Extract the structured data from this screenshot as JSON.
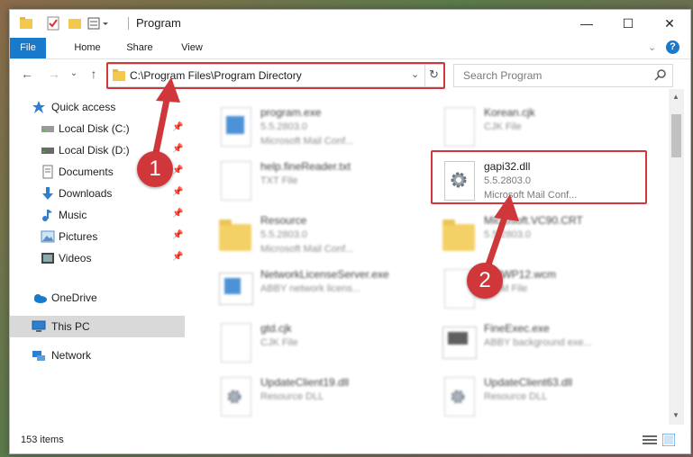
{
  "window": {
    "title": "Program",
    "accent": "#1979ca",
    "highlight": "#d0373b"
  },
  "ribbon": {
    "tabs": [
      "File",
      "Home",
      "Share",
      "View"
    ]
  },
  "address": {
    "path": "C:\\Program Files\\Program Directory",
    "search_placeholder": "Search Program"
  },
  "sidebar": {
    "items": [
      {
        "label": "Quick access",
        "icon": "star-icon"
      },
      {
        "label": "Local Disk (C:)",
        "icon": "drive-icon",
        "pinned": true
      },
      {
        "label": "Local Disk (D:)",
        "icon": "drive-icon",
        "pinned": true
      },
      {
        "label": "Documents",
        "icon": "documents-icon",
        "pinned": true
      },
      {
        "label": "Downloads",
        "icon": "download-icon",
        "pinned": true
      },
      {
        "label": "Music",
        "icon": "music-icon",
        "pinned": true
      },
      {
        "label": "Pictures",
        "icon": "pictures-icon",
        "pinned": true
      },
      {
        "label": "Videos",
        "icon": "videos-icon",
        "pinned": true
      },
      {
        "label": "OneDrive",
        "icon": "cloud-icon"
      },
      {
        "label": "This PC",
        "icon": "computer-icon",
        "selected": true
      },
      {
        "label": "Network",
        "icon": "network-icon"
      }
    ]
  },
  "files": [
    {
      "name": "program.exe",
      "line2": "5.5.2803.0",
      "line3": "Microsoft Mail Conf...",
      "kind": "exe"
    },
    {
      "name": "Korean.cjk",
      "line2": "CJK File",
      "line3": "",
      "kind": "doc"
    },
    {
      "name": "help.fineReader.txt",
      "line2": "TXT File",
      "line3": "",
      "kind": "doc"
    },
    {
      "name": "gapi32.dll",
      "line2": "5.5.2803.0",
      "line3": "Microsoft Mail Conf...",
      "kind": "dll",
      "highlighted": true
    },
    {
      "name": "Resource",
      "line2": "5.5.2803.0",
      "line3": "Microsoft Mail Conf...",
      "kind": "folder"
    },
    {
      "name": "Microsoft.VC90.CRT",
      "line2": "5.5.2803.0",
      "line3": "",
      "kind": "folder"
    },
    {
      "name": "NetworkLicenseServer.exe",
      "line2": "ABBY network licens...",
      "line3": "",
      "kind": "exe"
    },
    {
      "name": "WPWP12.wcm",
      "line2": "WCM File",
      "line3": "",
      "kind": "doc"
    },
    {
      "name": "gtd.cjk",
      "line2": "CJK File",
      "line3": "",
      "kind": "doc"
    },
    {
      "name": "FineExec.exe",
      "line2": "ABBY background exe...",
      "line3": "",
      "kind": "exe"
    },
    {
      "name": "UpdateClient19.dll",
      "line2": "Resource DLL",
      "line3": "",
      "kind": "dll"
    },
    {
      "name": "UpdateClient63.dll",
      "line2": "Resource DLL",
      "line3": "",
      "kind": "dll"
    }
  ],
  "status": {
    "count": "153 items"
  },
  "annotations": [
    "1",
    "2"
  ]
}
